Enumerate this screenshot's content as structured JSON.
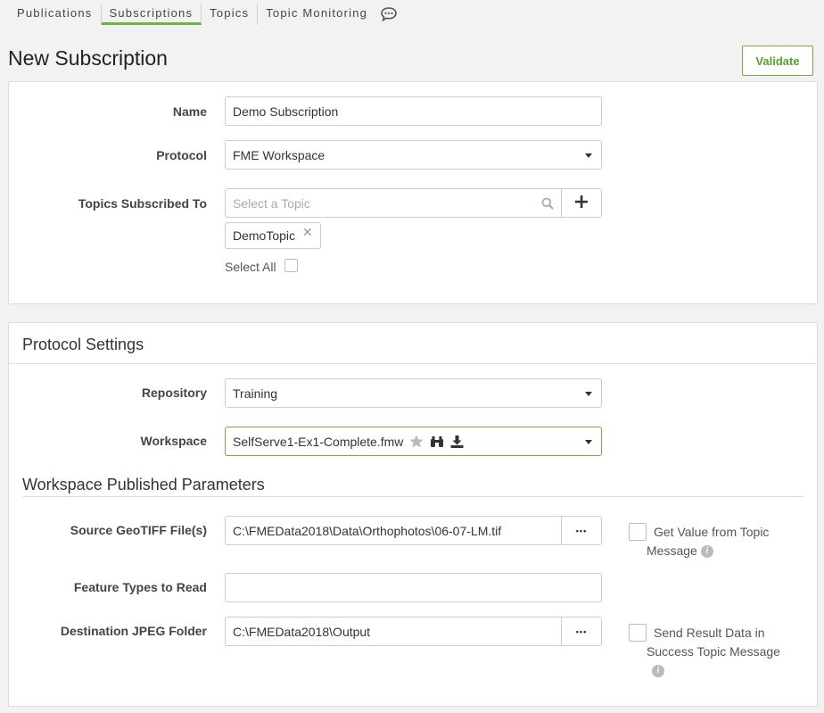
{
  "nav": {
    "tabs": [
      "Publications",
      "Subscriptions",
      "Topics",
      "Topic Monitoring"
    ],
    "active": "Subscriptions",
    "chat_icon": "chat-bubble-icon"
  },
  "page": {
    "title": "New Subscription",
    "validate_label": "Validate"
  },
  "colors": {
    "accent": "#6cb33f",
    "validate_text": "#5aa02c"
  },
  "general": {
    "name_label": "Name",
    "name_value": "Demo Subscription",
    "protocol_label": "Protocol",
    "protocol_value": "FME Workspace",
    "topics_label": "Topics Subscribed To",
    "topics_placeholder": "Select a Topic",
    "topics_selected": [
      "DemoTopic"
    ],
    "select_all_label": "Select All"
  },
  "protocol_settings": {
    "title": "Protocol Settings",
    "repository_label": "Repository",
    "repository_value": "Training",
    "workspace_label": "Workspace",
    "workspace_value": "SelfServe1-Ex1-Complete.fmw",
    "workspace_icons": [
      "star-icon",
      "binoculars-icon",
      "download-icon"
    ]
  },
  "published_params": {
    "title": "Workspace Published Parameters",
    "source_label": "Source GeoTIFF File(s)",
    "source_value": "C:\\FMEData2018\\Data\\Orthophotos\\06-07-LM.tif",
    "source_browse": "•••",
    "get_value_label_line1": "Get Value from Topic",
    "get_value_label_line2": "Message",
    "feature_types_label": "Feature Types to Read",
    "feature_types_value": "",
    "dest_label": "Destination JPEG Folder",
    "dest_value": "C:\\FMEData2018\\Output",
    "dest_browse": "•••",
    "send_result_line1": "Send Result Data in",
    "send_result_line2": "Success Topic Message"
  }
}
